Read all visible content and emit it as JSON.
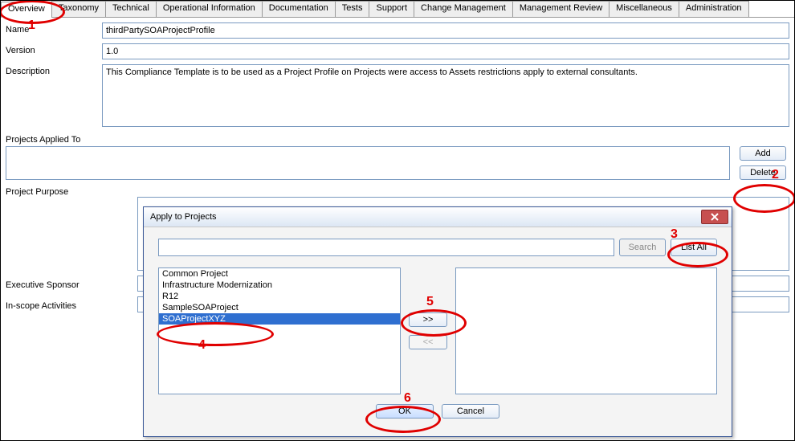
{
  "tabs": [
    "Overview",
    "Taxonomy",
    "Technical",
    "Operational Information",
    "Documentation",
    "Tests",
    "Support",
    "Change Management",
    "Management Review",
    "Miscellaneous",
    "Administration"
  ],
  "fields": {
    "name_label": "Name",
    "name_value": "thirdPartySOAProjectProfile",
    "version_label": "Version",
    "version_value": "1.0",
    "description_label": "Description",
    "description_value": "This Compliance Template is to be used as a Project Profile on Projects were access to Assets restrictions apply to external consultants.",
    "projects_label": "Projects Applied To",
    "purpose_label": "Project Purpose",
    "sponsor_label": "Executive Sponsor",
    "scope_label": "In-scope Activities"
  },
  "buttons": {
    "add": "Add",
    "delete": "Delete",
    "search": "Search",
    "list_all": "List All",
    "ok": "OK",
    "cancel": "Cancel",
    "move_right": ">>",
    "move_left": "<<"
  },
  "dialog": {
    "title": "Apply to Projects",
    "search_value": "",
    "available": [
      "Common Project",
      "Infrastructure Modernization",
      "R12",
      "SampleSOAProject",
      "SOAProjectXYZ"
    ],
    "selected_index": 4,
    "chosen": []
  },
  "annotations": {
    "1": "1",
    "2": "2",
    "3": "3",
    "4": "4",
    "5": "5",
    "6": "6"
  }
}
